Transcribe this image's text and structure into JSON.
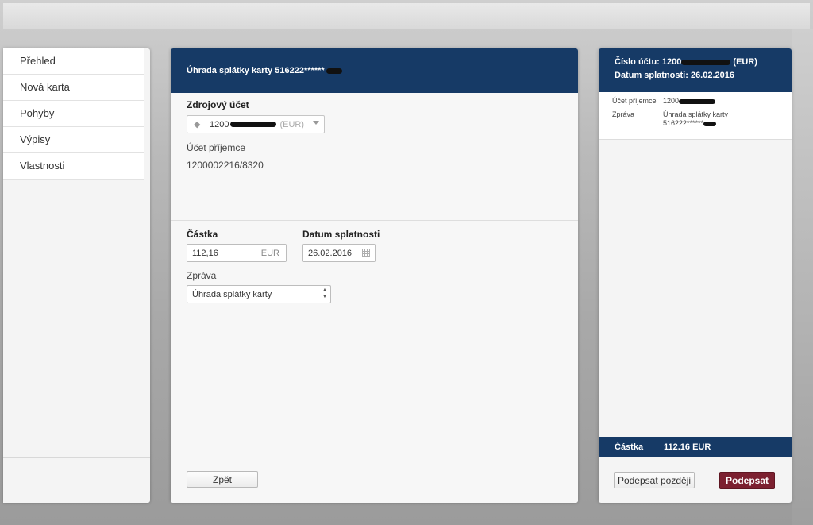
{
  "sidebar": {
    "items": [
      {
        "label": "Přehled"
      },
      {
        "label": "Nová karta"
      },
      {
        "label": "Pohyby"
      },
      {
        "label": "Výpisy"
      },
      {
        "label": "Vlastnosti"
      }
    ]
  },
  "main": {
    "header_title": "Úhrada splátky karty 516222******",
    "source_account_label": "Zdrojový účet",
    "source_account_value": "1200",
    "source_account_currency": "(EUR)",
    "recipient_label": "Účet příjemce",
    "recipient_value": "1200002216/8320",
    "amount_label": "Částka",
    "amount_value": "112,16",
    "amount_currency": "EUR",
    "due_date_label": "Datum splatnosti",
    "due_date_value": "26.02.2016",
    "message_label": "Zpráva",
    "message_value": "Úhrada splátky karty",
    "back_button": "Zpět"
  },
  "summary": {
    "account_label": "Číslo účtu: 1200",
    "account_currency": "(EUR)",
    "due_date_text": "Datum splatnosti: 26.02.2016",
    "recipient_label": "Účet příjemce",
    "recipient_value": "1200",
    "message_label": "Zpráva",
    "message_value_line1": "Úhrada splátky karty",
    "message_value_line2": "516222******",
    "amount_label": "Částka",
    "amount_value": "112.16 EUR",
    "sign_later_button": "Podepsat později",
    "sign_button": "Podepsat"
  },
  "colors": {
    "header_blue": "#163a66",
    "sign_button": "#7c2030"
  }
}
